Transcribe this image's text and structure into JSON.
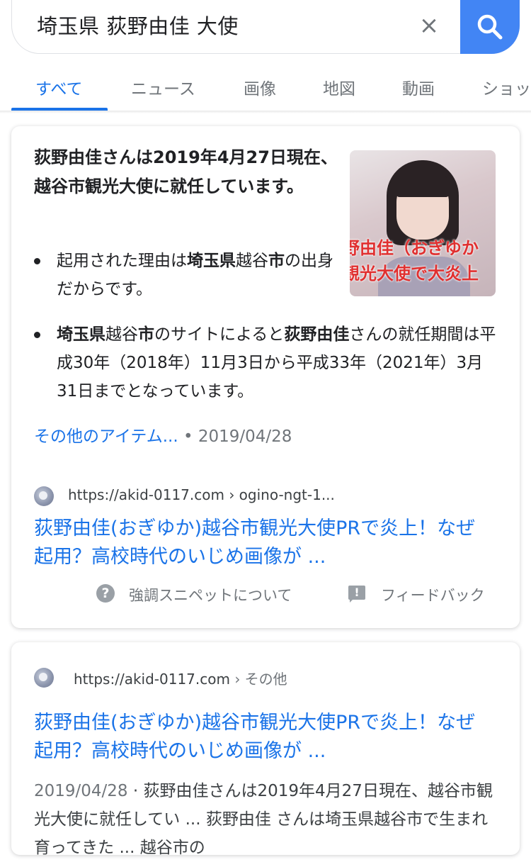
{
  "search": {
    "query": "埼玉県 荻野由佳 大使",
    "clear_label": "×"
  },
  "tabs": [
    {
      "label": "すべて",
      "active": true
    },
    {
      "label": "ニュース",
      "active": false
    },
    {
      "label": "画像",
      "active": false
    },
    {
      "label": "地図",
      "active": false
    },
    {
      "label": "動画",
      "active": false
    },
    {
      "label": "ショッ",
      "active": false
    }
  ],
  "featured": {
    "heading": "荻野由佳さんは2019年4月27日現在、越谷市観光大使に就任しています。",
    "bullets": [
      {
        "parts": [
          {
            "text": "起用された理由は",
            "bold": false
          },
          {
            "text": "埼玉県",
            "bold": true
          },
          {
            "text": "越谷",
            "bold": false
          },
          {
            "text": "市",
            "bold": true
          },
          {
            "text": "の出身だからです。",
            "bold": false
          }
        ]
      },
      {
        "parts": [
          {
            "text": "埼玉県",
            "bold": true
          },
          {
            "text": "越谷",
            "bold": false
          },
          {
            "text": "市",
            "bold": true
          },
          {
            "text": "のサイトによると",
            "bold": false
          },
          {
            "text": "荻野由佳",
            "bold": true
          },
          {
            "text": "さんの就任期間は平成30年（2018年）11月3日から平成33年（2021年）3月31日までとなっています。",
            "bold": false
          }
        ]
      }
    ],
    "thumbnail_overlay": [
      "野由佳（おぎゆか",
      "観光大使で大炎上"
    ],
    "more_link": "その他のアイテム...",
    "more_date": " • 2019/04/28",
    "site_url": "https://akid-0117.com",
    "site_path": " › ogino-ngt-1...",
    "title": "荻野由佳(おぎゆか)越谷市観光大使PRで炎上！なぜ起用？高校時代のいじめ画像が ...",
    "about_label": "強調スニペットについて",
    "feedback_label": "フィードバック"
  },
  "result2": {
    "site_url": "https://akid-0117.com",
    "site_path": " › その他",
    "title": "荻野由佳(おぎゆか)越谷市観光大使PRで炎上！なぜ起用？高校時代のいじめ画像が ...",
    "date": "2019/04/28",
    "snippet": " · 荻野由佳さんは2019年4月27日現在、越谷市観光大使に就任してい ... 荻野由佳 さんは埼玉県越谷市で生まれ育ってきた ... 越谷市の"
  },
  "colors": {
    "accent": "#1a73e8",
    "search_button": "#4285f4",
    "muted": "#70757a"
  },
  "icons": [
    "search-icon",
    "close-icon",
    "globe-icon",
    "help-icon",
    "feedback-icon"
  ]
}
